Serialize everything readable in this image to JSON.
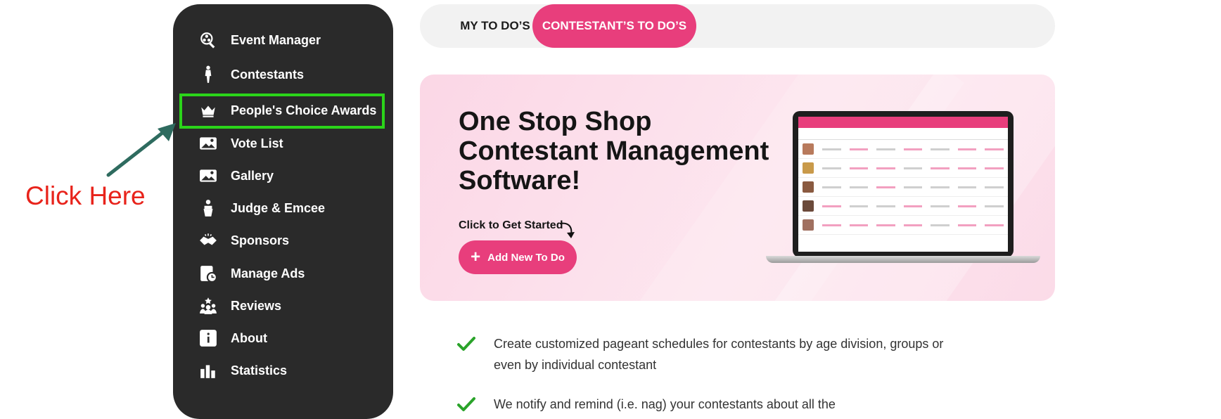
{
  "sidebar": {
    "items": [
      {
        "label": "Event Manager",
        "icon": "event-manager-icon"
      },
      {
        "label": "Contestants",
        "icon": "contestant-icon"
      },
      {
        "label": "People's Choice Awards",
        "icon": "crown-icon"
      },
      {
        "label": "Vote List",
        "icon": "image-list-icon"
      },
      {
        "label": "Gallery",
        "icon": "gallery-icon"
      },
      {
        "label": "Judge & Emcee",
        "icon": "judge-icon"
      },
      {
        "label": "Sponsors",
        "icon": "handshake-icon"
      },
      {
        "label": "Manage Ads",
        "icon": "manage-ads-icon"
      },
      {
        "label": "Reviews",
        "icon": "reviews-icon"
      },
      {
        "label": "About",
        "icon": "info-icon"
      },
      {
        "label": "Statistics",
        "icon": "bar-chart-icon"
      }
    ]
  },
  "annotation": {
    "text": "Click Here",
    "color": "#e8231b",
    "highlight_color": "#2bd41a"
  },
  "tabs": {
    "my_todos": "MY TO DO’S",
    "contestant_todos": "CONTESTANT’S TO DO’S",
    "active": "contestant_todos"
  },
  "hero": {
    "title": "One Stop Shop Contestant Management Software!",
    "cta_label": "Click to Get Started",
    "add_button": "Add New To Do"
  },
  "features": [
    "Create customized pageant schedules for contestants by age division, groups or even by individual contestant",
    "We notify and remind (i.e. nag) your contestants about all the"
  ],
  "colors": {
    "accent": "#e83e7c",
    "sidebar_bg": "#2a2a2a",
    "check": "#2aa32a"
  }
}
